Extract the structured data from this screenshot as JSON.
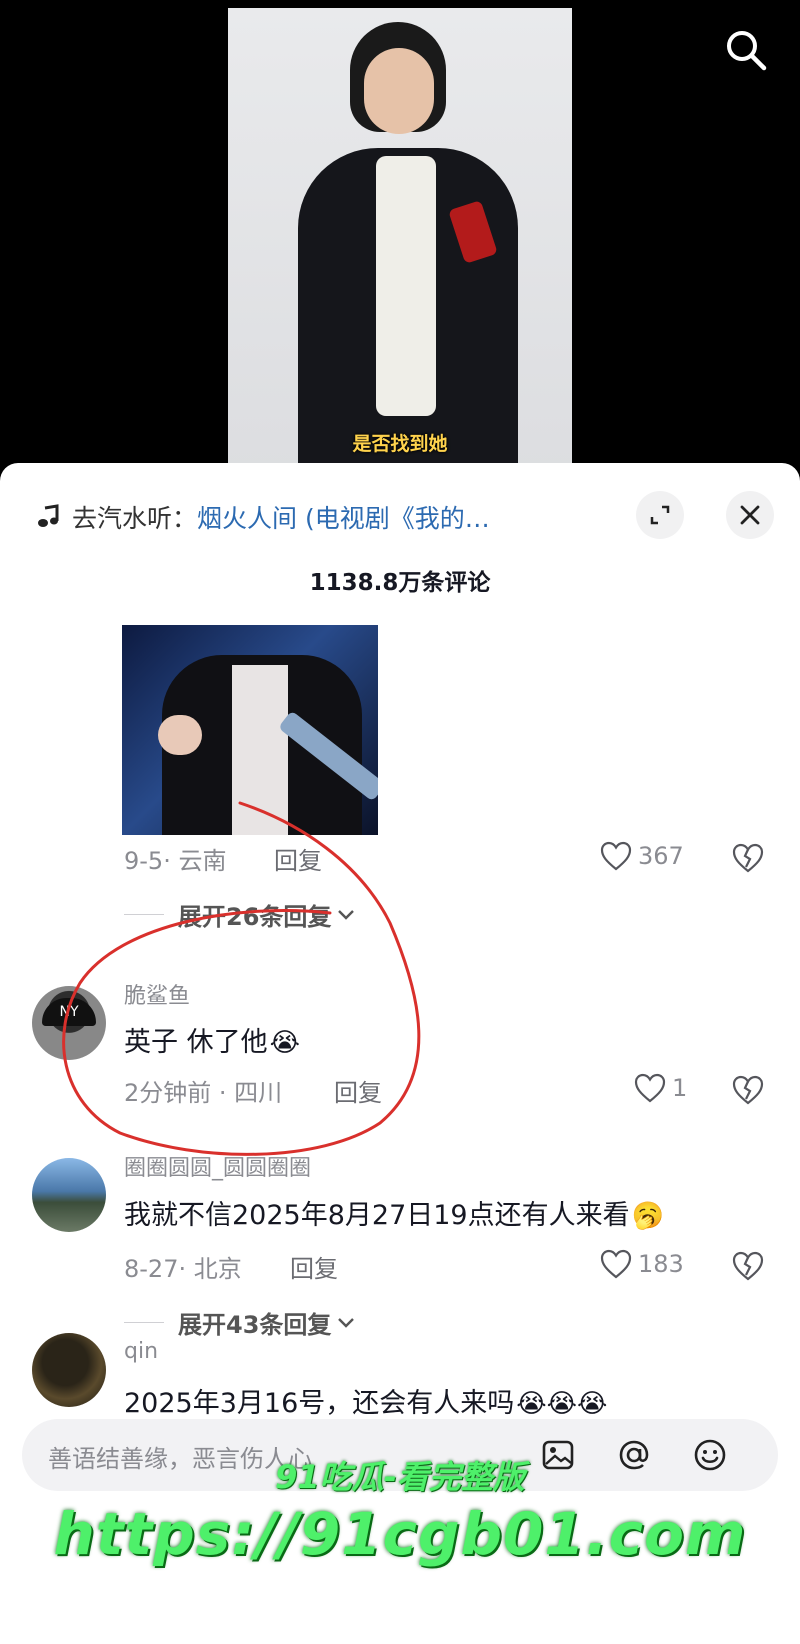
{
  "video": {
    "subtitle": "是否找到她"
  },
  "sheet": {
    "music_prefix": "去汽水听：",
    "music_song": "烟火人间 (电视剧《我的…",
    "comment_count": "1138.8万条评论",
    "icons": {
      "music": "music-note-icon",
      "expand": "expand-icon",
      "close": "close-icon",
      "search": "search-icon"
    }
  },
  "comments": [
    {
      "meta": "9-5· 云南",
      "reply": "回复",
      "likes": "367",
      "expand": "展开26条回复"
    },
    {
      "username": "脆鲨鱼",
      "text": "英子 休了他",
      "emoji": "😭",
      "meta": "2分钟前 · 四川",
      "reply": "回复",
      "likes": "1"
    },
    {
      "username": "圈圈圆圆_圆圆圈圈",
      "text": "我就不信2025年8月27日19点还有人来看",
      "emoji": "🥱",
      "meta": "8-27· 北京",
      "reply": "回复",
      "likes": "183",
      "expand": "展开43条回复"
    },
    {
      "username": "qin",
      "text": "2025年3月16号，还会有人来吗",
      "emoji": "😭😭😭"
    }
  ],
  "input": {
    "placeholder": "善语结善缘，恶言伤人心"
  },
  "watermark": {
    "line1": "91吃瓜-看完整版",
    "line2": "https://91cgb01.com"
  },
  "colors": {
    "accent_link": "#2c6ab1",
    "annotation_red": "#d9302c",
    "watermark_green": "#4ef06a"
  }
}
